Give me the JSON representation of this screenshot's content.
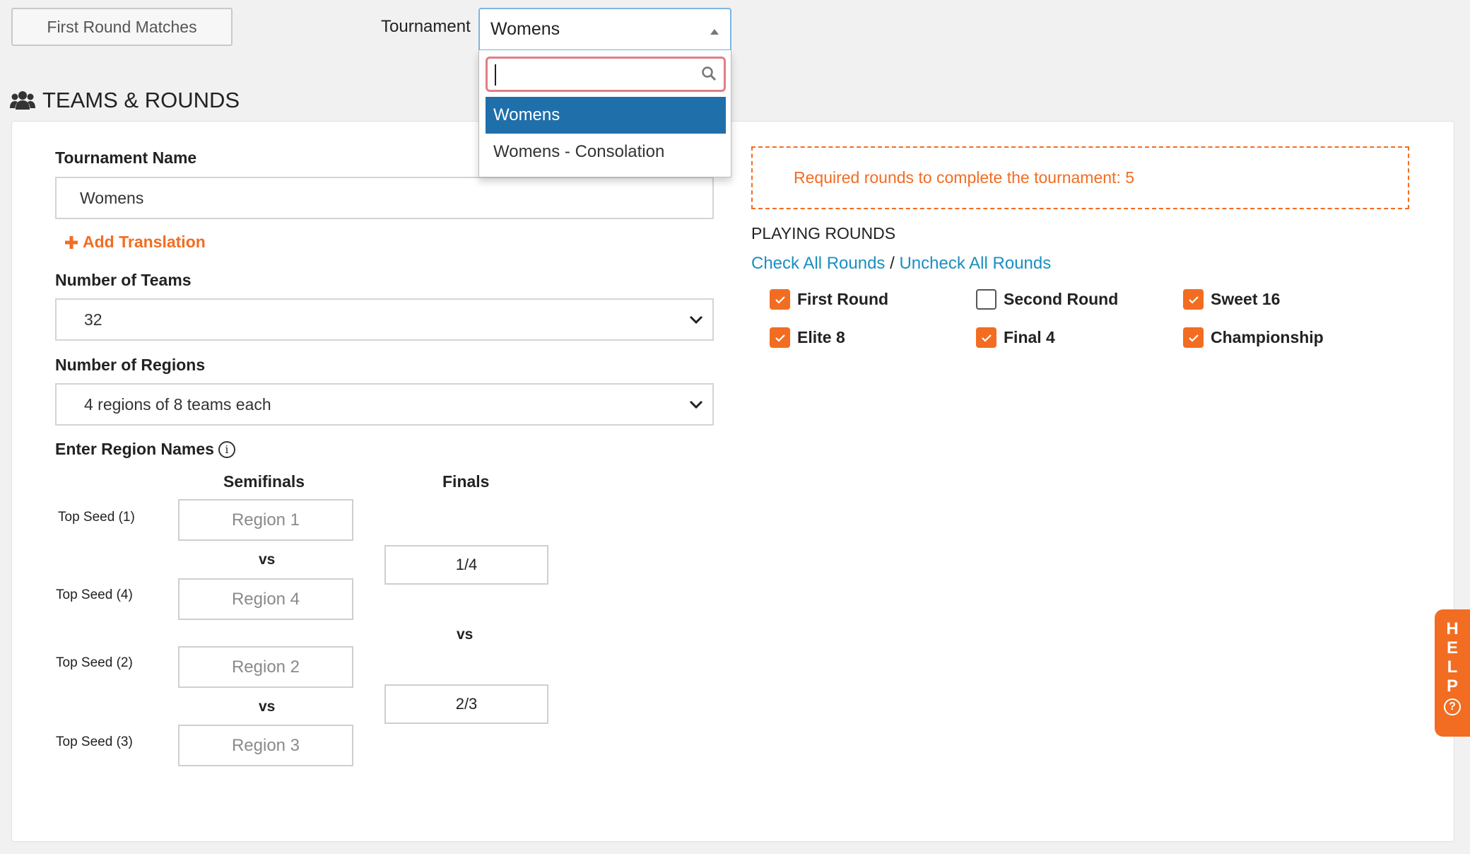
{
  "topbar": {
    "first_round_button": "First Round Matches",
    "tournament_label": "Tournament",
    "tournament_value": "Womens",
    "dropdown": {
      "search_value": "",
      "options": [
        "Womens",
        "Womens - Consolation"
      ],
      "selected_index": 0
    }
  },
  "section": {
    "title": "TEAMS & ROUNDS"
  },
  "form": {
    "tournament_name_label": "Tournament Name",
    "tournament_name_value": "Womens",
    "add_translation": "Add Translation",
    "num_teams_label": "Number of Teams",
    "num_teams_value": "32",
    "num_regions_label": "Number of Regions",
    "num_regions_value": "4 regions of 8 teams each",
    "region_names_label": "Enter Region Names",
    "semifinals_header": "Semifinals",
    "finals_header": "Finals",
    "vs": "vs",
    "seeds": [
      {
        "label": "Top Seed (1)",
        "placeholder": "Region 1"
      },
      {
        "label": "Top Seed (4)",
        "placeholder": "Region 4"
      },
      {
        "label": "Top Seed (2)",
        "placeholder": "Region 2"
      },
      {
        "label": "Top Seed (3)",
        "placeholder": "Region 3"
      }
    ],
    "finals": [
      "1/4",
      "2/3"
    ]
  },
  "rounds": {
    "required_text": "Required rounds to complete the tournament: 5",
    "playing_rounds_title": "PLAYING ROUNDS",
    "check_all": "Check All Rounds",
    "separator": "/",
    "uncheck_all": "Uncheck All Rounds",
    "items": [
      {
        "label": "First Round",
        "checked": true
      },
      {
        "label": "Second Round",
        "checked": false
      },
      {
        "label": "Sweet 16",
        "checked": true
      },
      {
        "label": "Elite 8",
        "checked": true
      },
      {
        "label": "Final 4",
        "checked": true
      },
      {
        "label": "Championship",
        "checked": true
      }
    ]
  },
  "help": {
    "letters": [
      "H",
      "E",
      "L",
      "P"
    ],
    "icon": "question-circle-icon"
  },
  "colors": {
    "accent": "#f26d21",
    "selected": "#1f6fab",
    "link": "#1a8fc1"
  }
}
